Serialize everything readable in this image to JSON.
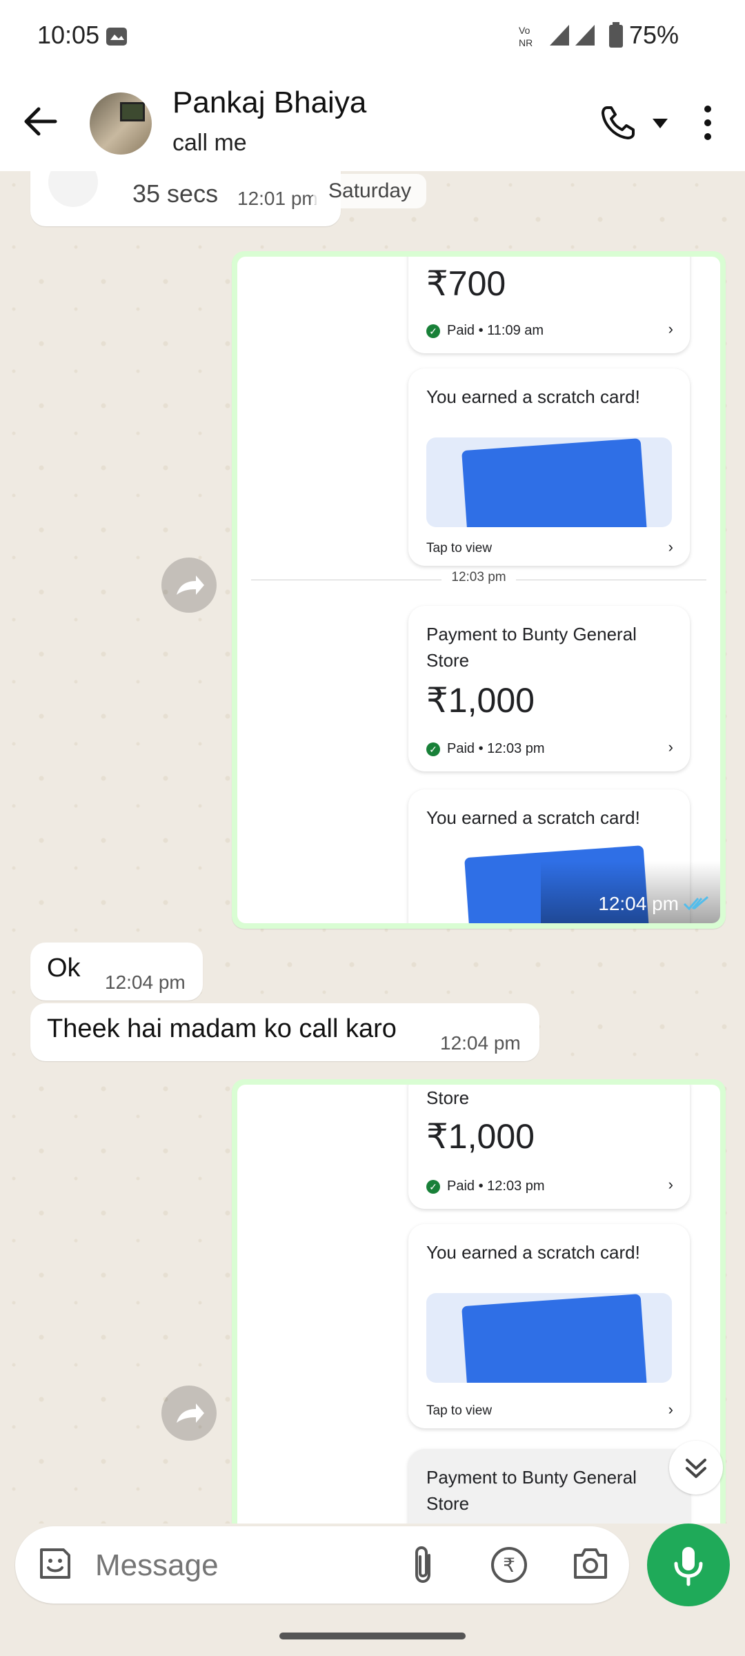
{
  "status_bar": {
    "time": "10:05",
    "battery": "75%"
  },
  "header": {
    "contact_name": "Pankaj Bhaiya",
    "status": "call me"
  },
  "chat": {
    "prev_call": {
      "duration": "35 secs",
      "time": "12:01 pm"
    },
    "day_label": "Saturday",
    "image1": {
      "card1_amount": "₹700",
      "card1_paid": "Paid • 11:09 am",
      "scratch_title": "You earned a scratch card!",
      "tap_view": "Tap to view",
      "divider_time": "12:03 pm",
      "payment_title_l1": "Payment to Bunty General",
      "payment_title_l2": "Store",
      "payment_amount": "₹1,000",
      "payment_paid": "Paid • 12:03 pm",
      "scratch_title2": "You earned a scratch card!",
      "time": "12:04 pm"
    },
    "msg_ok": {
      "text": "Ok",
      "time": "12:04 pm"
    },
    "msg_call": {
      "text": "Theek hai madam ko call karo",
      "time": "12:04 pm"
    },
    "image2": {
      "store": "Store",
      "payment_amount": "₹1,000",
      "payment_paid": "Paid • 12:03 pm",
      "scratch_title": "You earned a scratch card!",
      "tap_view": "Tap to view",
      "payment_title_l1": "Payment to Bunty General",
      "payment_title_l2": "Store"
    }
  },
  "input": {
    "placeholder": "Message"
  },
  "colors": {
    "accent_green": "#1faa59",
    "bubble_out": "#d9fdd3",
    "read_tick": "#53bdeb",
    "gpay_blue": "#2f6fe6"
  }
}
